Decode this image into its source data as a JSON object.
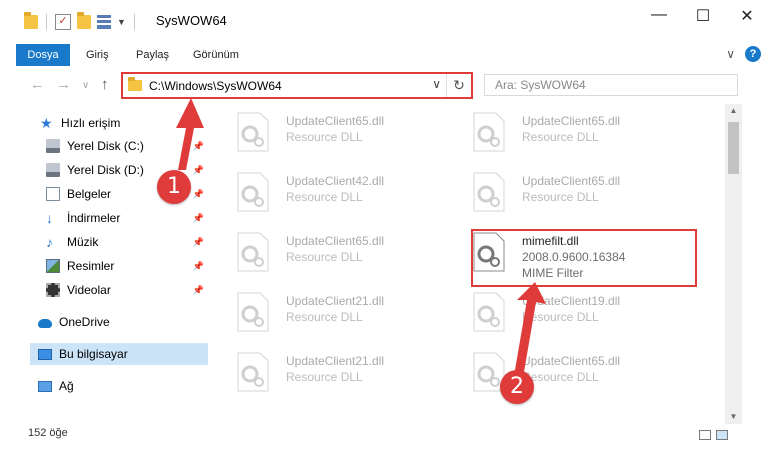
{
  "window": {
    "title": "SysWOW64",
    "minimize": "—",
    "maximize": "☐",
    "close": "✕"
  },
  "ribbon": {
    "tabs": [
      "Dosya",
      "Giriş",
      "Paylaş",
      "Görünüm"
    ]
  },
  "nav": {
    "back": "←",
    "forward": "→",
    "recent": "∨",
    "up": "↑",
    "address": "C:\\Windows\\SysWOW64",
    "refresh": "↻",
    "search_placeholder": "Ara: SysWOW64"
  },
  "sidebar": {
    "quick_access": "Hızlı erişim",
    "items": [
      {
        "label": "Yerel Disk (C:)",
        "pinned": true
      },
      {
        "label": "Yerel Disk (D:)",
        "pinned": true
      },
      {
        "label": "Belgeler",
        "pinned": true
      },
      {
        "label": "İndirmeler",
        "pinned": true
      },
      {
        "label": "Müzik",
        "pinned": true
      },
      {
        "label": "Resimler",
        "pinned": true
      },
      {
        "label": "Videolar",
        "pinned": true
      }
    ],
    "onedrive": "OneDrive",
    "this_pc": "Bu bilgisayar",
    "network": "Ağ"
  },
  "files": [
    {
      "name": "UpdateClient65.dll",
      "desc": "Resource DLL"
    },
    {
      "name": "UpdateClient65.dll",
      "desc": "Resource DLL"
    },
    {
      "name": "UpdateClient42.dll",
      "desc": "Resource DLL"
    },
    {
      "name": "UpdateClient65.dll",
      "desc": "Resource DLL"
    },
    {
      "name": "UpdateClient65.dll",
      "desc": "Resource DLL"
    },
    {
      "name": "mimefilt.dll",
      "version": "2008.0.9600.16384",
      "desc": "MIME Filter"
    },
    {
      "name": "UpdateClient21.dll",
      "desc": "Resource DLL"
    },
    {
      "name": "UpdateClient19.dll",
      "desc": "Resource DLL"
    },
    {
      "name": "UpdateClient21.dll",
      "desc": "Resource DLL"
    },
    {
      "name": "UpdateClient65.dll",
      "desc": "Resource DLL"
    }
  ],
  "status": {
    "count": "152 öğe"
  },
  "badges": [
    "1",
    "2"
  ],
  "colors": {
    "accent": "#1979ca",
    "highlight": "#e03b3b",
    "selection": "#cce4f7"
  }
}
